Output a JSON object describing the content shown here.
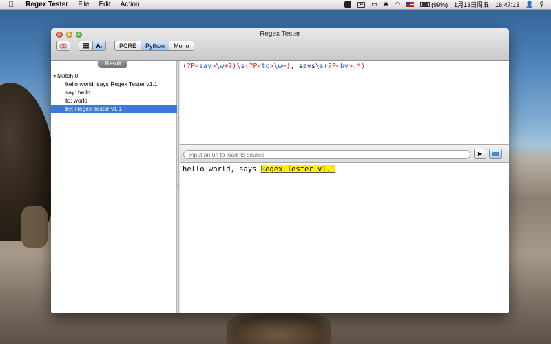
{
  "menubar": {
    "app_name": "Regex Tester",
    "items": [
      "File",
      "Edit",
      "Action"
    ],
    "battery": "(99%)",
    "date": "1月13日周五",
    "time": "16:47:13"
  },
  "window": {
    "title": "Regex Tester",
    "engines": [
      "PCRE",
      "Python",
      "Mono"
    ],
    "selected_engine": "Python"
  },
  "result": {
    "tab_label": "Result",
    "match_label": "Match 0",
    "groups": [
      "hello world, says Regex Tester v1.1",
      "say: hello",
      "to: world",
      "by: Regex Tester v1.1"
    ]
  },
  "regex": {
    "pattern": "(?P<say>\\w+?)\\s(?P<to>\\w+), says\\s(?P<by>.*)",
    "tokens": [
      {
        "t": "(?P<",
        "c": "red"
      },
      {
        "t": "say",
        "c": "blue"
      },
      {
        "t": ">",
        "c": "red"
      },
      {
        "t": "\\w",
        "c": "blue"
      },
      {
        "t": "+?",
        "c": "red"
      },
      {
        "t": ")",
        "c": "red"
      },
      {
        "t": "\\s",
        "c": "blue"
      },
      {
        "t": "(?P<",
        "c": "red"
      },
      {
        "t": "to",
        "c": "blue"
      },
      {
        "t": ">",
        "c": "red"
      },
      {
        "t": "\\w",
        "c": "blue"
      },
      {
        "t": "+",
        "c": "red"
      },
      {
        "t": ")",
        "c": "red"
      },
      {
        "t": ", says",
        "c": "dark"
      },
      {
        "t": "\\s",
        "c": "blue"
      },
      {
        "t": "(?P<",
        "c": "red"
      },
      {
        "t": "by",
        "c": "blue"
      },
      {
        "t": ">",
        "c": "red"
      },
      {
        "t": ".*",
        "c": "red"
      },
      {
        "t": ")",
        "c": "red"
      }
    ]
  },
  "url": {
    "placeholder": "input an url to load its source"
  },
  "test": {
    "before": "hello world, says ",
    "highlight": "Regex Tester v1.1"
  }
}
